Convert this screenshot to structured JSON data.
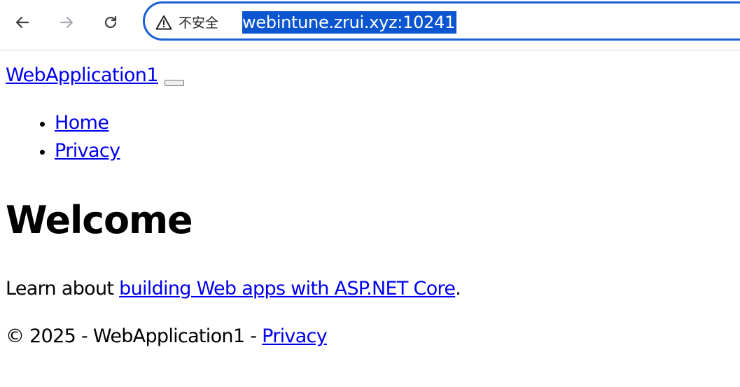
{
  "browser": {
    "address_bar": {
      "security_label": "不安全",
      "url": "webintune.zrui.xyz:10241"
    },
    "icons": {
      "back": "back-arrow-icon",
      "forward": "forward-arrow-icon",
      "reload": "reload-icon",
      "security": "warning-triangle-icon"
    }
  },
  "navbar": {
    "brand": "WebApplication1",
    "links": [
      {
        "label": "Home"
      },
      {
        "label": "Privacy"
      }
    ]
  },
  "main": {
    "heading": "Welcome",
    "intro_prefix": "Learn about ",
    "intro_link": "building Web apps with ASP.NET Core",
    "intro_suffix": "."
  },
  "footer": {
    "text": "© 2025 - WebApplication1 - ",
    "privacy_link": "Privacy"
  },
  "colors": {
    "link": "#0000ee",
    "omnibox_border": "#1a5fd4",
    "url_selection": "#0b56d0"
  }
}
